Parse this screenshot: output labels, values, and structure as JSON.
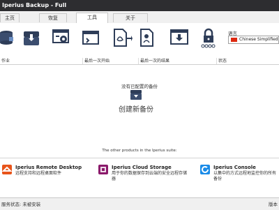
{
  "app": {
    "title": "Iperius Backup - Full"
  },
  "tabs": [
    {
      "label": "主页"
    },
    {
      "label": "恢复"
    },
    {
      "label": "工具"
    },
    {
      "label": "关于"
    }
  ],
  "toolbar": {
    "icons": [
      "database-tool-icon",
      "backup-tool-icon",
      "settings-window-icon",
      "window-tool-icon",
      "pdf-export-icon",
      "pdf-settings-icon",
      "download-window-icon",
      "password-lock-icon"
    ]
  },
  "language": {
    "label": "语言",
    "selected": "Chinese Simplified"
  },
  "table": {
    "columns": [
      "作业",
      "最后一次开始",
      "最后一次的结果",
      "状态"
    ]
  },
  "empty": {
    "message": "没有已配置的备份",
    "create_label": "创建新备份"
  },
  "other_products": {
    "heading": "The other products in the Iperius suite:",
    "items": [
      {
        "name": "Iperius Remote Desktop",
        "desc": "远程支持和远程桌面软件",
        "color": "#e8541a"
      },
      {
        "name": "Iperius Cloud Storage",
        "desc": "用于你的数据保存到云端的安全远程存储器",
        "color": "#8b1a6b"
      },
      {
        "name": "Iperius Console",
        "desc": "以集中的方式远程地监控你的所有备份",
        "color": "#1a8be8"
      }
    ]
  },
  "status": {
    "text": "服务状态: 未被安装",
    "version": "版本"
  }
}
